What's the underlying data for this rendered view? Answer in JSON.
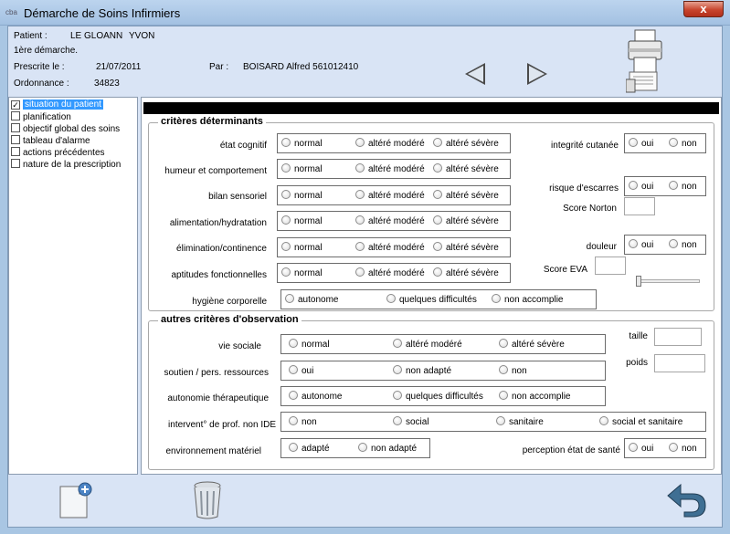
{
  "window": {
    "app_icon": "cba",
    "title": "Démarche de Soins Infirmiers",
    "close": "x"
  },
  "header": {
    "patient_label": "Patient :",
    "patient_name": "LE GLOANN",
    "patient_first": "YVON",
    "demarche": "1ère démarche.",
    "prescrite_label": "Prescrite le :",
    "prescrite_date": "21/07/2011",
    "par_label": "Par :",
    "par_value": "BOISARD Alfred 561012410",
    "ordonnance_label": "Ordonnance :",
    "ordonnance_value": "34823"
  },
  "sidebar": {
    "items": [
      {
        "label": "situation du patient",
        "checked": true
      },
      {
        "label": "planification",
        "checked": false
      },
      {
        "label": "objectif global des soins",
        "checked": false
      },
      {
        "label": "tableau d'alarme",
        "checked": false
      },
      {
        "label": "actions précédentes",
        "checked": false
      },
      {
        "label": "nature de la prescription",
        "checked": false
      }
    ]
  },
  "criteres": {
    "legend": "critères déterminants",
    "rows": [
      {
        "label": "état cognitif",
        "o1": "normal",
        "o2": "altéré modéré",
        "o3": "altéré sévère"
      },
      {
        "label": "humeur et comportement",
        "o1": "normal",
        "o2": "altéré modéré",
        "o3": "altéré sévère"
      },
      {
        "label": "bilan sensoriel",
        "o1": "normal",
        "o2": "altéré modéré",
        "o3": "altéré sévère"
      },
      {
        "label": "alimentation/hydratation",
        "o1": "normal",
        "o2": "altéré modéré",
        "o3": "altéré sévère"
      },
      {
        "label": "élimination/continence",
        "o1": "normal",
        "o2": "altéré modéré",
        "o3": "altéré sévère"
      },
      {
        "label": "aptitudes fonctionnelles",
        "o1": "normal",
        "o2": "altéré modéré",
        "o3": "altéré sévère"
      }
    ],
    "hygiene": {
      "label": "hygiène corporelle",
      "o1": "autonome",
      "o2": "quelques difficultés",
      "o3": "non accomplie"
    },
    "integrite": {
      "label": "integrité cutanée",
      "o1": "oui",
      "o2": "non"
    },
    "escarres": {
      "label": "risque d'escarres",
      "o1": "oui",
      "o2": "non"
    },
    "norton": {
      "label": "Score Norton"
    },
    "douleur": {
      "label": "douleur",
      "o1": "oui",
      "o2": "non"
    },
    "eva": {
      "label": "Score EVA"
    }
  },
  "autres": {
    "legend": "autres critères d'observation",
    "vie_sociale": {
      "label": "vie sociale",
      "o1": "normal",
      "o2": "altéré modéré",
      "o3": "altéré sévère"
    },
    "soutien": {
      "label": "soutien / pers. ressources",
      "o1": "oui",
      "o2": "non adapté",
      "o3": "non"
    },
    "autonomie": {
      "label": "autonomie thérapeutique",
      "o1": "autonome",
      "o2": "quelques difficultés",
      "o3": "non accomplie"
    },
    "intervent": {
      "label": "intervent° de prof. non IDE",
      "o1": "non",
      "o2": "social",
      "o3": "sanitaire",
      "o4": "social et sanitaire"
    },
    "environnement": {
      "label": "environnement matériel",
      "o1": "adapté",
      "o2": "non adapté"
    },
    "perception": {
      "label": "perception état de santé",
      "o1": "oui",
      "o2": "non"
    },
    "taille": {
      "label": "taille"
    },
    "poids": {
      "label": "poids"
    }
  },
  "icons": {
    "printer": "printer-icon",
    "prev": "arrow-left-icon",
    "next": "arrow-right-icon",
    "new_doc": "new-document-icon",
    "trash": "trash-icon",
    "back": "undo-arrow-icon"
  }
}
